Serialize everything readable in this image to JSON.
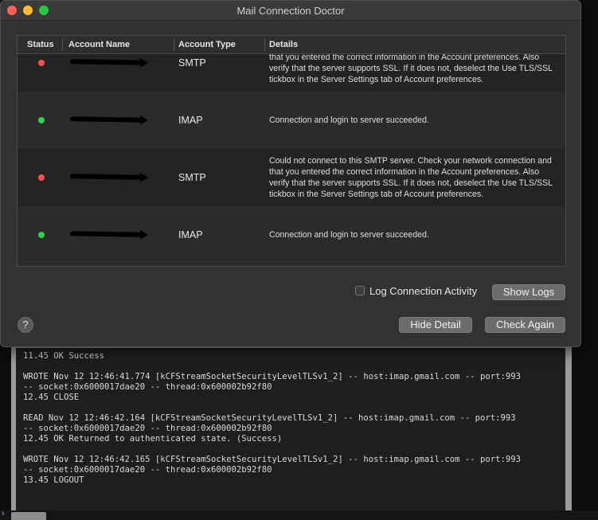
{
  "window": {
    "title": "Mail Connection Doctor"
  },
  "table": {
    "headers": {
      "status": "Status",
      "name": "Account Name",
      "type": "Account Type",
      "details": "Details"
    },
    "rows": [
      {
        "status": "red",
        "name": "[redacted]",
        "type": "SMTP",
        "details": "Could not connect to this SMTP server. Check your network connection and that you entered the correct information in the Account preferences. Also verify that the server supports SSL. If it does not, deselect the Use TLS/SSL tickbox in the Server Settings tab of Account preferences."
      },
      {
        "status": "green",
        "name": "[redacted]",
        "type": "IMAP",
        "details": "Connection and login to server succeeded."
      },
      {
        "status": "red",
        "name": "[redacted]",
        "type": "SMTP",
        "details": "Could not connect to this SMTP server. Check your network connection and that you entered the correct information in the Account preferences. Also verify that the server supports SSL. If it does not, deselect the Use TLS/SSL tickbox in the Server Settings tab of Account preferences."
      },
      {
        "status": "green",
        "name": "[redacted]",
        "type": "IMAP",
        "details": "Connection and login to server succeeded."
      }
    ]
  },
  "controls": {
    "log_checkbox_label": "Log Connection Activity",
    "log_checkbox_checked": false,
    "show_logs": "Show Logs",
    "hide_detail": "Hide Detail",
    "check_again": "Check Again",
    "help": "?"
  },
  "colors": {
    "status_red": "#ff4d4d",
    "status_green": "#2bd44a"
  },
  "log": {
    "lines": [
      "11.45 OK Success",
      "",
      "WROTE Nov 12 12:46:41.774 [kCFStreamSocketSecurityLevelTLSv1_2] -- host:imap.gmail.com -- port:993",
      "-- socket:0x6000017dae20 -- thread:0x600002b92f80",
      "12.45 CLOSE",
      "",
      "READ Nov 12 12:46:42.164 [kCFStreamSocketSecurityLevelTLSv1_2] -- host:imap.gmail.com -- port:993",
      "-- socket:0x6000017dae20 -- thread:0x600002b92f80",
      "12.45 OK Returned to authenticated state. (Success)",
      "",
      "WROTE Nov 12 12:46:42.165 [kCFStreamSocketSecurityLevelTLSv1_2] -- host:imap.gmail.com -- port:993",
      "-- socket:0x6000017dae20 -- thread:0x600002b92f80",
      "13.45 LOGOUT"
    ]
  }
}
